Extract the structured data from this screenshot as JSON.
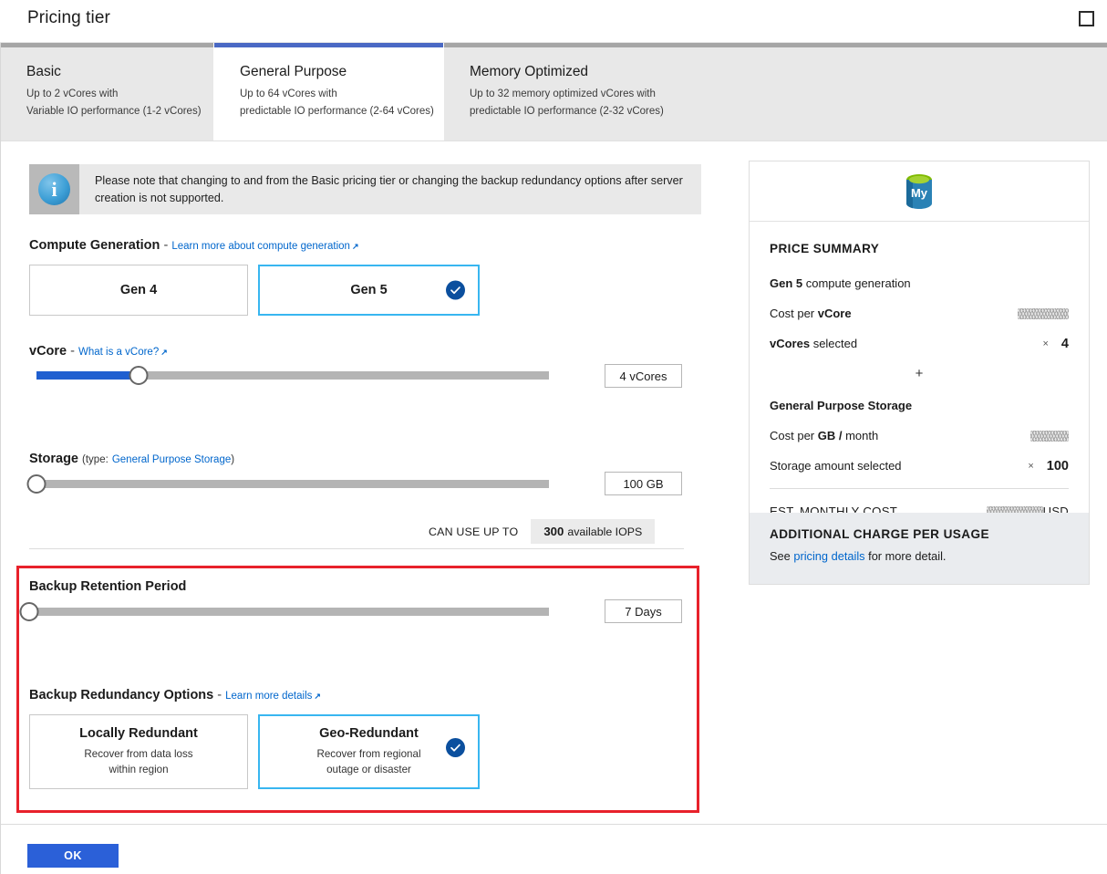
{
  "window": {
    "title": "Pricing tier",
    "maximize_icon": "maximize-icon"
  },
  "tabs": [
    {
      "id": "basic",
      "label": "Basic",
      "line1": "Up to 2 vCores with",
      "line2": "Variable IO performance (1-2 vCores)",
      "active": false
    },
    {
      "id": "general-purpose",
      "label": "General Purpose",
      "line1": "Up to 64 vCores with",
      "line2": "predictable IO performance (2-64 vCores)",
      "active": true
    },
    {
      "id": "memory-optimized",
      "label": "Memory Optimized",
      "line1": "Up to 32 memory optimized vCores with",
      "line2": "predictable IO performance (2-32 vCores)",
      "active": false
    }
  ],
  "info_banner": {
    "icon": "info-icon",
    "glyph": "i",
    "text": "Please note that changing to and from the Basic pricing tier or changing the backup redundancy options after server creation is not supported."
  },
  "compute_generation": {
    "label": "Compute Generation",
    "separator": "-",
    "link": "Learn more about compute generation",
    "options": [
      {
        "title": "Gen 4",
        "selected": false
      },
      {
        "title": "Gen 5",
        "selected": true
      }
    ]
  },
  "vcore": {
    "label": "vCore",
    "separator": "-",
    "link": "What is a vCore?",
    "value_label": "4 vCores",
    "value": 4,
    "segments": 5,
    "filled_fraction": 0.2,
    "thumb_percent": 20
  },
  "storage": {
    "label": "Storage",
    "note_prefix": "(type:",
    "link": "General Purpose Storage",
    "note_suffix": ")",
    "value_label": "100 GB",
    "value": 100,
    "thumb_percent": 0,
    "iops": {
      "prefix": "CAN USE UP TO",
      "number": "300",
      "suffix": "available IOPS"
    }
  },
  "backup_retention": {
    "label": "Backup Retention Period",
    "value_label": "7 Days",
    "value": 7,
    "segments": 28,
    "thumb_percent": 0
  },
  "backup_redundancy": {
    "label": "Backup Redundancy Options",
    "separator": "-",
    "link": "Learn more details",
    "options": [
      {
        "title": "Locally Redundant",
        "line1": "Recover from data loss",
        "line2": "within region",
        "selected": false
      },
      {
        "title": "Geo-Redundant",
        "line1": "Recover from regional",
        "line2": "outage or disaster",
        "selected": true
      }
    ]
  },
  "price_summary": {
    "logo_icon": "mysql-database-icon",
    "heading": "PRICE SUMMARY",
    "gen_line_bold": "Gen 5",
    "gen_line_rest": " compute generation",
    "rows": [
      {
        "label_plain": "Cost per ",
        "label_bold": "vCore",
        "value": "",
        "redacted": true,
        "multiplier": ""
      },
      {
        "label_bold": "vCores",
        "label_plain": " selected",
        "value": "4",
        "redacted": false,
        "multiplier": "×"
      }
    ],
    "plus": "+",
    "storage_heading": "General Purpose Storage",
    "storage_rows": [
      {
        "label_plain": "Cost per ",
        "label_bold": "GB /",
        "label_tail": " month",
        "value": "",
        "redacted": true,
        "multiplier": ""
      },
      {
        "label_plain": "Storage amount selected",
        "value": "100",
        "redacted": false,
        "multiplier": "×"
      }
    ],
    "total_label": "EST. MONTHLY COST",
    "total_currency": "USD",
    "total_redacted": true,
    "additional_heading": "ADDITIONAL CHARGE PER USAGE",
    "additional_prefix": "See ",
    "additional_link": "pricing details",
    "additional_suffix": " for more detail."
  },
  "footer": {
    "ok_label": "OK"
  },
  "colors": {
    "accent_blue": "#2b60d8",
    "tab_active_bar": "#4a69c4",
    "selected_border": "#38b6f0",
    "check_badge": "#0b4f9e",
    "slider_fill": "#1f5fd0",
    "highlight_red": "#e8212b",
    "link": "#0066cc"
  }
}
